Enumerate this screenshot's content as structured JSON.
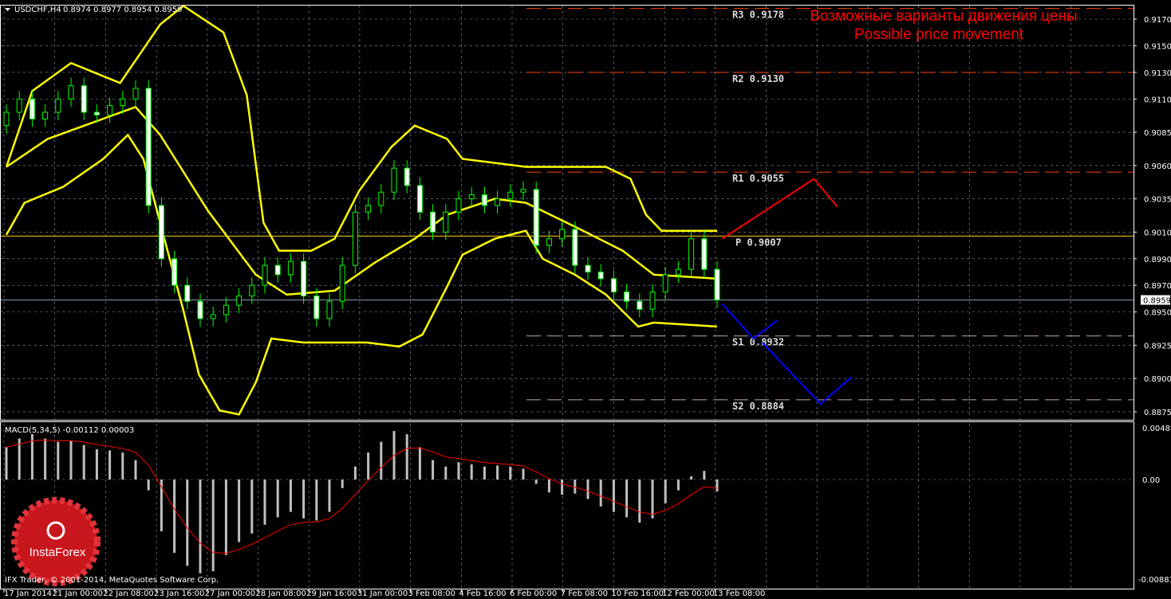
{
  "header": {
    "symbol": "USDCHF,H4",
    "ohlc": "0.8974 0.8977 0.8954 0.8959"
  },
  "annotation": {
    "line1": "Возможные варианты движения цены",
    "line2": "Possible price movement"
  },
  "macd_label": "MACD(5,34,5) -0.00112 0.00003",
  "copyright": "IFX Trader, © 2001-2014, MetaQuotes Software Corp.",
  "logo_text": "InstaForex",
  "colors": {
    "bands": "#ffff00",
    "bull": "#000000",
    "bear": "#ffffff",
    "wick": "#00ff00",
    "up_forecast": "#ff0000",
    "down_forecast": "#0000ff",
    "pivot": "#ffcc00",
    "levels": "#ff4400",
    "grid": "#8a9aaa"
  },
  "chart_data": {
    "type": "candlestick",
    "symbol": "USDCHF",
    "timeframe": "H4",
    "ylim": [
      0.8862,
      0.919
    ],
    "y_ticks": [
      "0.9170",
      "0.9150",
      "0.9130",
      "0.9110",
      "0.9085",
      "0.9060",
      "0.9035",
      "0.9010",
      "0.8990",
      "0.8970",
      "0.8950",
      "0.8925",
      "0.8900",
      "0.8875"
    ],
    "current_price": "0.8959",
    "x_ticks": [
      "17 Jan 2014",
      "21 Jan 00:00",
      "22 Jan 08:00",
      "23 Jan 16:00",
      "27 Jan 00:00",
      "28 Jan 08:00",
      "29 Jan 16:00",
      "31 Jan 00:00",
      "3 Feb 08:00",
      "4 Feb 16:00",
      "6 Feb 00:00",
      "7 Feb 08:00",
      "10 Feb 16:00",
      "12 Feb 00:00",
      "13 Feb 08:00"
    ],
    "closes": [
      0.91,
      0.911,
      0.9095,
      0.91,
      0.911,
      0.912,
      0.91,
      0.9098,
      0.9105,
      0.911,
      0.9118,
      0.903,
      0.899,
      0.897,
      0.8958,
      0.8945,
      0.8948,
      0.8955,
      0.8962,
      0.897,
      0.8985,
      0.8978,
      0.8988,
      0.8962,
      0.8945,
      0.8958,
      0.8985,
      0.9025,
      0.903,
      0.904,
      0.9058,
      0.9045,
      0.9025,
      0.901,
      0.9025,
      0.9035,
      0.9038,
      0.903,
      0.9035,
      0.904,
      0.9042,
      0.9,
      0.9005,
      0.9012,
      0.8985,
      0.898,
      0.8975,
      0.8965,
      0.8958,
      0.8952,
      0.8965,
      0.8978,
      0.8982,
      0.9005,
      0.8982,
      0.8959
    ],
    "first_open": 0.909,
    "bollinger": {
      "upper": [
        [
          0,
          0.9059
        ],
        [
          2,
          0.9116
        ],
        [
          5,
          0.9137
        ],
        [
          8.8,
          0.9122
        ],
        [
          11.9,
          0.9166
        ],
        [
          13.7,
          0.918
        ],
        [
          16.8,
          0.916
        ],
        [
          18.6,
          0.9113
        ],
        [
          19.9,
          0.9017
        ],
        [
          21.1,
          0.8996
        ],
        [
          23.6,
          0.8996
        ],
        [
          25.4,
          0.9005
        ],
        [
          27.3,
          0.9041
        ],
        [
          29.8,
          0.9074
        ],
        [
          31.6,
          0.909
        ],
        [
          34.1,
          0.908
        ],
        [
          35.3,
          0.9065
        ],
        [
          40.2,
          0.9059
        ],
        [
          46.4,
          0.9059
        ],
        [
          48.3,
          0.905
        ],
        [
          49.5,
          0.9023
        ],
        [
          50.7,
          0.9011
        ],
        [
          55,
          0.9011
        ]
      ],
      "middle": [
        [
          0,
          0.9059
        ],
        [
          3.2,
          0.908
        ],
        [
          10,
          0.9104
        ],
        [
          11.9,
          0.9083
        ],
        [
          15.6,
          0.9026
        ],
        [
          19.3,
          0.8978
        ],
        [
          21.7,
          0.8963
        ],
        [
          25.4,
          0.8966
        ],
        [
          28.5,
          0.8987
        ],
        [
          31.6,
          0.9005
        ],
        [
          34.1,
          0.9023
        ],
        [
          37.8,
          0.9035
        ],
        [
          40.2,
          0.9032
        ],
        [
          44,
          0.9014
        ],
        [
          47.7,
          0.8996
        ],
        [
          50.1,
          0.8978
        ],
        [
          55,
          0.8975
        ]
      ],
      "lower": [
        [
          0,
          0.9008
        ],
        [
          1.4,
          0.9032
        ],
        [
          4.4,
          0.9044
        ],
        [
          7.5,
          0.9065
        ],
        [
          9.4,
          0.9083
        ],
        [
          10.6,
          0.9065
        ],
        [
          11.9,
          0.9017
        ],
        [
          13.7,
          0.8951
        ],
        [
          14.9,
          0.8903
        ],
        [
          16.5,
          0.8876
        ],
        [
          18,
          0.8873
        ],
        [
          19.3,
          0.8897
        ],
        [
          20.5,
          0.893
        ],
        [
          23,
          0.8927
        ],
        [
          27.9,
          0.8927
        ],
        [
          30.4,
          0.8924
        ],
        [
          32.2,
          0.8933
        ],
        [
          34.1,
          0.8969
        ],
        [
          35.3,
          0.8993
        ],
        [
          37.8,
          0.9005
        ],
        [
          40.2,
          0.9011
        ],
        [
          41.5,
          0.899
        ],
        [
          44,
          0.8978
        ],
        [
          46.4,
          0.8963
        ],
        [
          48.9,
          0.8939
        ],
        [
          50.1,
          0.8942
        ],
        [
          55,
          0.8939
        ]
      ]
    },
    "pivots": [
      {
        "label": "R3",
        "value": "0.9178"
      },
      {
        "label": "R2",
        "value": "0.9130"
      },
      {
        "label": "R1",
        "value": "0.9055"
      },
      {
        "label": "P",
        "value": "0.9007"
      },
      {
        "label": "S1",
        "value": "0.8932"
      },
      {
        "label": "S2",
        "value": "0.8884"
      }
    ],
    "forecast_up": [
      [
        55.4,
        0.9005
      ],
      [
        62.5,
        0.905
      ],
      [
        64.3,
        0.9029
      ]
    ],
    "forecast_down_1": [
      [
        55.4,
        0.8956
      ],
      [
        57.8,
        0.893
      ],
      [
        59.7,
        0.8944
      ]
    ],
    "forecast_down_2": [
      [
        58.5,
        0.8927
      ],
      [
        63,
        0.8881
      ],
      [
        65.4,
        0.8901
      ]
    ],
    "macd": {
      "params": "5,34,5",
      "ylim": [
        -0.00881,
        0.0048
      ],
      "y_ticks": [
        "0.0048",
        "0.00",
        "-0.00881"
      ],
      "histogram": [
        0.003,
        0.0038,
        0.0042,
        0.0038,
        0.0035,
        0.0036,
        0.0032,
        0.0028,
        0.0027,
        0.0025,
        0.0018,
        -0.001,
        -0.0048,
        -0.0068,
        -0.008,
        -0.0087,
        -0.0085,
        -0.007,
        -0.0058,
        -0.005,
        -0.0042,
        -0.0035,
        -0.003,
        -0.0036,
        -0.0038,
        -0.003,
        -0.0008,
        0.0012,
        0.0025,
        0.0035,
        0.0045,
        0.0042,
        0.003,
        0.0018,
        0.0012,
        0.0016,
        0.0014,
        0.0012,
        0.0013,
        0.0012,
        0.001,
        -0.0004,
        -0.0012,
        -0.0014,
        -0.0013,
        -0.0018,
        -0.0025,
        -0.003,
        -0.0035,
        -0.004,
        -0.0036,
        -0.0022,
        -0.001,
        0.0003,
        0.0008,
        -0.0011
      ]
    }
  }
}
